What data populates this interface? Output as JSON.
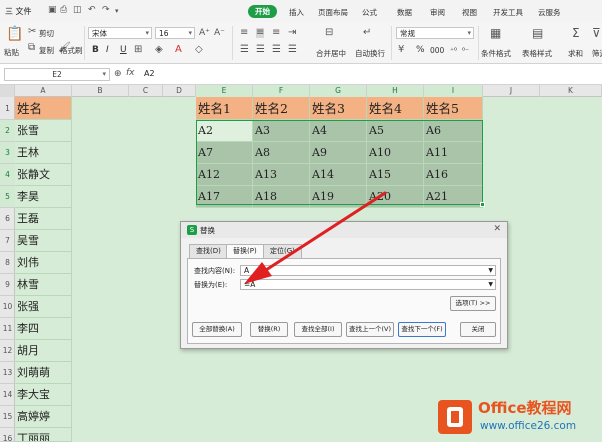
{
  "menubar": {
    "file_label": "三 文件",
    "tabs": [
      "开始",
      "插入",
      "页面布局",
      "公式",
      "数据",
      "审阅",
      "视图",
      "开发工具",
      "云服务"
    ],
    "active_tab": "开始"
  },
  "toolbar": {
    "paste": "粘贴",
    "cut": "剪切",
    "copy": "复制",
    "format_painter": "格式刷",
    "font_name": "宋体",
    "font_size": "16",
    "bold": "B",
    "italic": "I",
    "underline": "U",
    "merge_center": "合并居中",
    "auto_wrap": "自动换行",
    "number_format": "常规",
    "percent": "%",
    "thousands": "000",
    "conditional_format": "条件格式",
    "table_style": "表格样式",
    "sum": "求和",
    "filter": "筛选"
  },
  "formula_bar": {
    "name_box": "E2",
    "fx_label": "fx",
    "content": "A2"
  },
  "columns": [
    "A",
    "B",
    "C",
    "D",
    "E",
    "F",
    "G",
    "H",
    "I",
    "J",
    "K"
  ],
  "rows": [
    "1",
    "2",
    "3",
    "4",
    "5",
    "6",
    "7",
    "8",
    "9",
    "10",
    "11",
    "12",
    "13",
    "14",
    "15",
    "16"
  ],
  "column_a": [
    "姓名",
    "张雪",
    "王林",
    "张静文",
    "李昊",
    "王磊",
    "吴雪",
    "刘伟",
    "林雪",
    "张强",
    "李四",
    "胡月",
    "刘萌萌",
    "李大宝",
    "高婷婷",
    "丁丽丽"
  ],
  "table": {
    "headers": [
      "姓名1",
      "姓名2",
      "姓名3",
      "姓名4",
      "姓名5"
    ],
    "rows": [
      [
        "A2",
        "A3",
        "A4",
        "A5",
        "A6"
      ],
      [
        "A7",
        "A8",
        "A9",
        "A10",
        "A11"
      ],
      [
        "A12",
        "A13",
        "A14",
        "A15",
        "A16"
      ],
      [
        "A17",
        "A18",
        "A19",
        "A20",
        "A21"
      ]
    ]
  },
  "dialog": {
    "title": "替换",
    "tabs": [
      "查找(D)",
      "替换(P)",
      "定位(G)"
    ],
    "active_tab": "替换(P)",
    "find_label": "查找内容(N):",
    "find_value": "A",
    "replace_label": "替换为(E):",
    "replace_value": "=A",
    "options_button": "选项(T) >>",
    "buttons": [
      "全部替换(A)",
      "替换(R)",
      "查找全部(I)",
      "查找上一个(V)",
      "查找下一个(F)",
      "关闭"
    ]
  },
  "watermark": {
    "brand": "Office教程网",
    "url": "www.office26.com"
  },
  "colors": {
    "accent": "#1e9e47",
    "header_fill": "#f4b183",
    "table_fill": "#a9c4a9",
    "sheet_bg": "#d6ecd6",
    "arrow": "#e02020"
  }
}
